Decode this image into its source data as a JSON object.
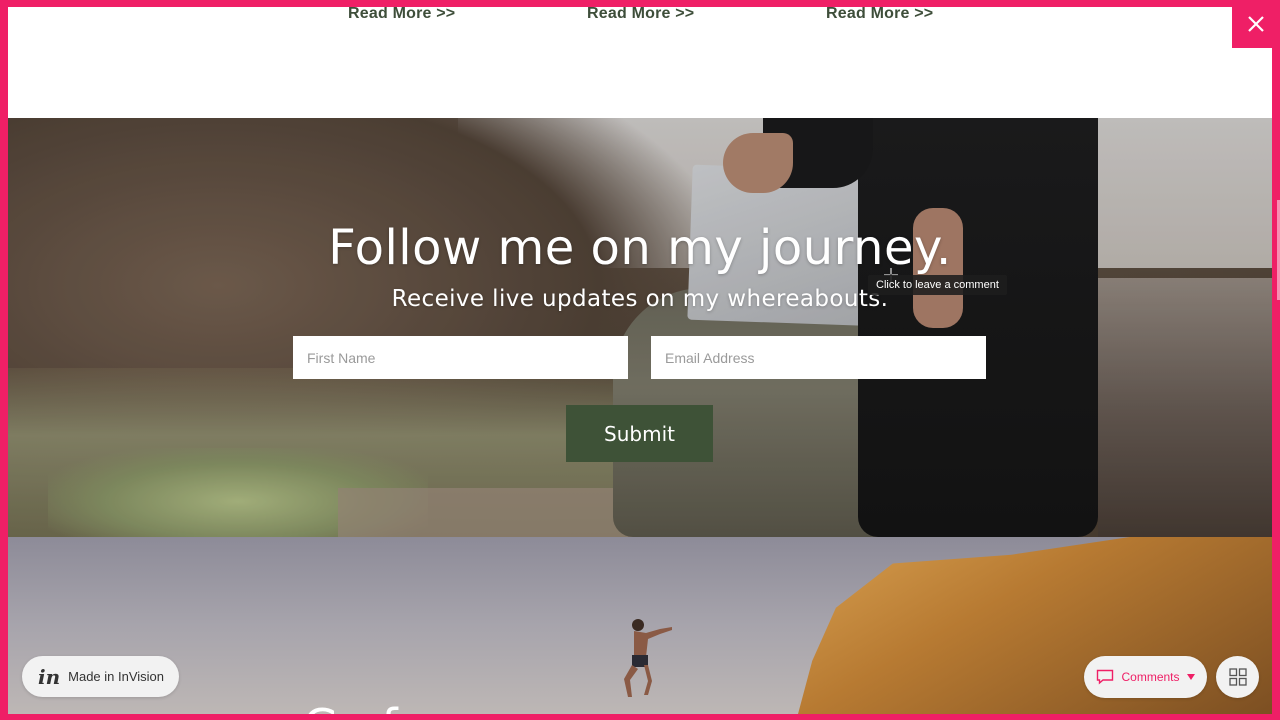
{
  "readmore": {
    "links": [
      "Read More >>",
      "Read More >>",
      "Read More >>"
    ]
  },
  "signup": {
    "title": "Follow me on my journey.",
    "subtitle": "Receive live updates on my whereabouts.",
    "first_name_placeholder": "First Name",
    "email_placeholder": "Email Address",
    "submit_label": "Submit"
  },
  "tooltip": {
    "text": "Click to leave a comment"
  },
  "lower": {
    "partial_title": "Go fo"
  },
  "invision": {
    "logo_text": "in",
    "label": "Made in InVision"
  },
  "comments": {
    "label": "Comments"
  },
  "colors": {
    "frame": "#ef1f66",
    "button": "#3e5237",
    "link": "#3e4e3a"
  }
}
